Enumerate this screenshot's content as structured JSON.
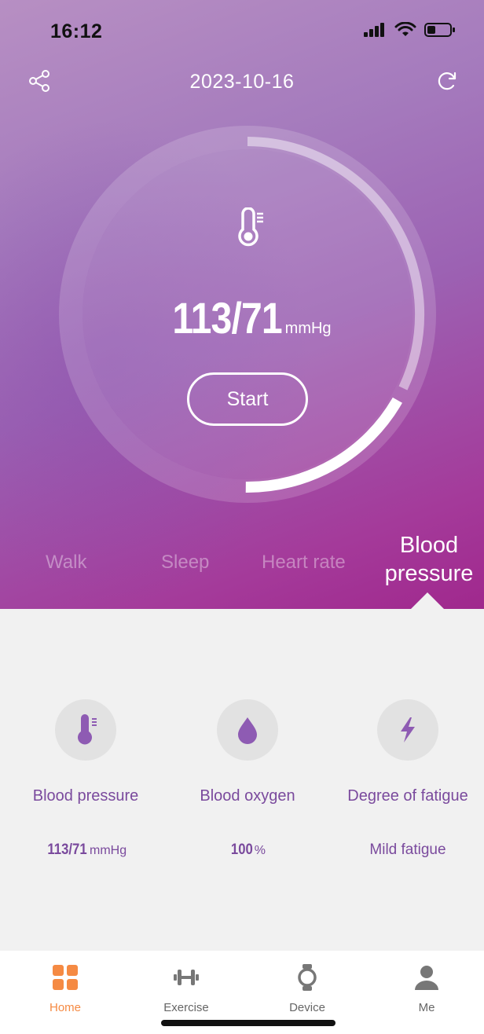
{
  "status_bar": {
    "time": "16:12"
  },
  "header": {
    "date": "2023-10-16"
  },
  "ring": {
    "value": "113/71",
    "unit": "mmHg",
    "start_label": "Start",
    "progress": 0.38
  },
  "tabs": [
    {
      "label": "Walk"
    },
    {
      "label": "Sleep"
    },
    {
      "label": "Heart rate"
    },
    {
      "label_line1": "Blood",
      "label_line2": "pressure",
      "active": true
    }
  ],
  "metrics": [
    {
      "label": "Blood pressure",
      "value": "113/71",
      "unit": "mmHg",
      "icon": "thermometer-icon"
    },
    {
      "label": "Blood oxygen",
      "value": "100",
      "unit": "%",
      "icon": "drop-icon"
    },
    {
      "label": "Degree of fatigue",
      "value": "Mild fatigue",
      "icon": "lightning-icon"
    }
  ],
  "nav": [
    {
      "label": "Home",
      "icon": "home-grid-icon",
      "active": true
    },
    {
      "label": "Exercise",
      "icon": "dumbbell-icon"
    },
    {
      "label": "Device",
      "icon": "watch-icon"
    },
    {
      "label": "Me",
      "icon": "person-icon"
    }
  ],
  "colors": {
    "accent": "#f58a43",
    "metric_text": "#7a4a9d",
    "hero_start": "#b78fc3",
    "hero_end": "#a0288d"
  }
}
